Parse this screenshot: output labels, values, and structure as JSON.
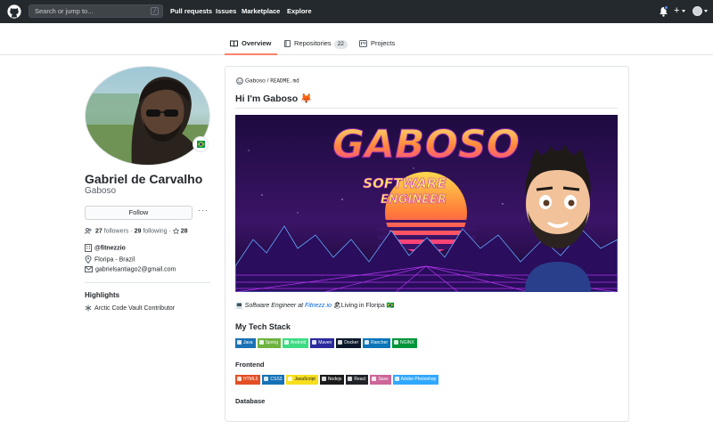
{
  "header": {
    "search_placeholder": "Search or jump to...",
    "search_key": "/",
    "nav": [
      "Pull requests",
      "Issues",
      "Marketplace",
      "Explore"
    ],
    "plus": "+"
  },
  "tabs": [
    {
      "label": "Overview",
      "active": true
    },
    {
      "label": "Repositories",
      "count": "22"
    },
    {
      "label": "Projects"
    }
  ],
  "profile": {
    "name": "Gabriel de Carvalho",
    "login": "Gaboso",
    "follow_label": "Follow",
    "more": "···",
    "followers_count": "27",
    "followers_label": "followers",
    "sep": "·",
    "following_count": "29",
    "following_label": "following",
    "stars_count": "28",
    "company": "@fitnezzio",
    "location": "Floripa - Brazil",
    "email": "gabrielsantiago2@gmail.com"
  },
  "highlights": {
    "title": "Highlights",
    "items": [
      "Arctic Code Vault Contributor"
    ]
  },
  "readme": {
    "owner": "Gaboso",
    "sep": " / ",
    "file": "README.md",
    "heading": "Hi I'm Gaboso 🦊",
    "banner_title": "GABOSO",
    "banner_sub1": "SOFTWARE",
    "banner_sub2": "ENGINEER",
    "tagline_pre": "💻 ",
    "tagline_role": "Software Engineer at ",
    "tagline_company": "Fitnezz.io",
    "tagline_post": " 🏖Living in Floripa 🇧🇷",
    "tech_title": "My Tech Stack",
    "tech_badges": [
      {
        "label": "Java",
        "color": "#1a71b5"
      },
      {
        "label": "Spring",
        "color": "#6db33f"
      },
      {
        "label": "Android",
        "color": "#3ddc84"
      },
      {
        "label": "Maven",
        "color": "#2a2b9c"
      },
      {
        "label": "Docker",
        "color": "#0b1a2b"
      },
      {
        "label": "Rancher",
        "color": "#0b75b8"
      },
      {
        "label": "NGINX",
        "color": "#009639"
      }
    ],
    "frontend_title": "Frontend",
    "frontend_badges": [
      {
        "label": "HTML5",
        "color": "#e34f26"
      },
      {
        "label": "CSS3",
        "color": "#1572b6"
      },
      {
        "label": "JavaScript",
        "color": "#f7df1e"
      },
      {
        "label": "Nodejs",
        "color": "#1b1b1b"
      },
      {
        "label": "React",
        "color": "#20232a"
      },
      {
        "label": "Sass",
        "color": "#cc6699"
      },
      {
        "label": "Adobe Photoshop",
        "color": "#31a8ff"
      }
    ],
    "database_title": "Database"
  }
}
